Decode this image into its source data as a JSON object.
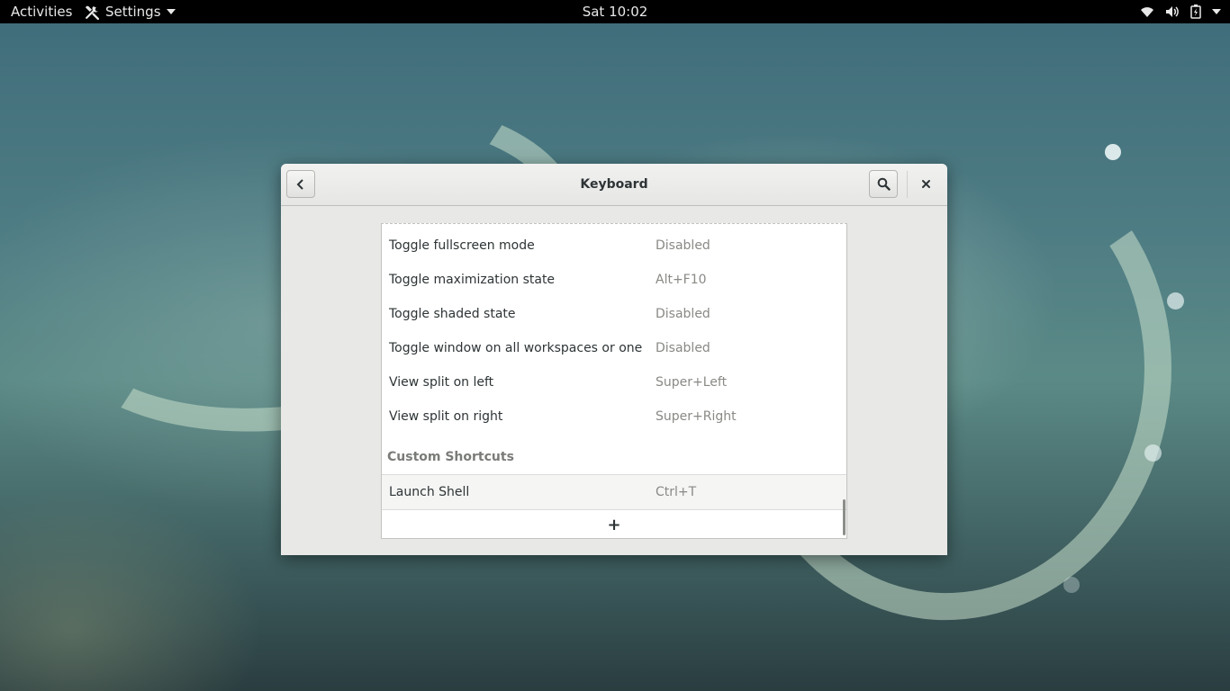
{
  "topbar": {
    "activities_label": "Activities",
    "app_menu_label": "Settings",
    "clock": "Sat 10:02"
  },
  "window": {
    "title": "Keyboard",
    "shortcuts": [
      {
        "name": "Toggle fullscreen mode",
        "accel": "Disabled"
      },
      {
        "name": "Toggle maximization state",
        "accel": "Alt+F10"
      },
      {
        "name": "Toggle shaded state",
        "accel": "Disabled"
      },
      {
        "name": "Toggle window on all workspaces or one",
        "accel": "Disabled"
      },
      {
        "name": "View split on left",
        "accel": "Super+Left"
      },
      {
        "name": "View split on right",
        "accel": "Super+Right"
      }
    ],
    "custom_section": {
      "header": "Custom Shortcuts",
      "items": [
        {
          "name": "Launch Shell",
          "accel": "Ctrl+T"
        }
      ],
      "add_label": "+"
    }
  },
  "icons": {
    "back": "go-previous-icon",
    "search": "search-icon",
    "close": "window-close-icon",
    "settings": "settings-tools-icon",
    "wifi": "wifi-icon",
    "volume": "volume-icon",
    "battery": "battery-icon",
    "system_menu": "system-menu-arrow-icon"
  },
  "colors": {
    "topbar_bg": "#000000",
    "window_bg": "#e8e8e7",
    "list_bg": "#ffffff",
    "text": "#2e3436",
    "accel_text": "#888a85"
  }
}
